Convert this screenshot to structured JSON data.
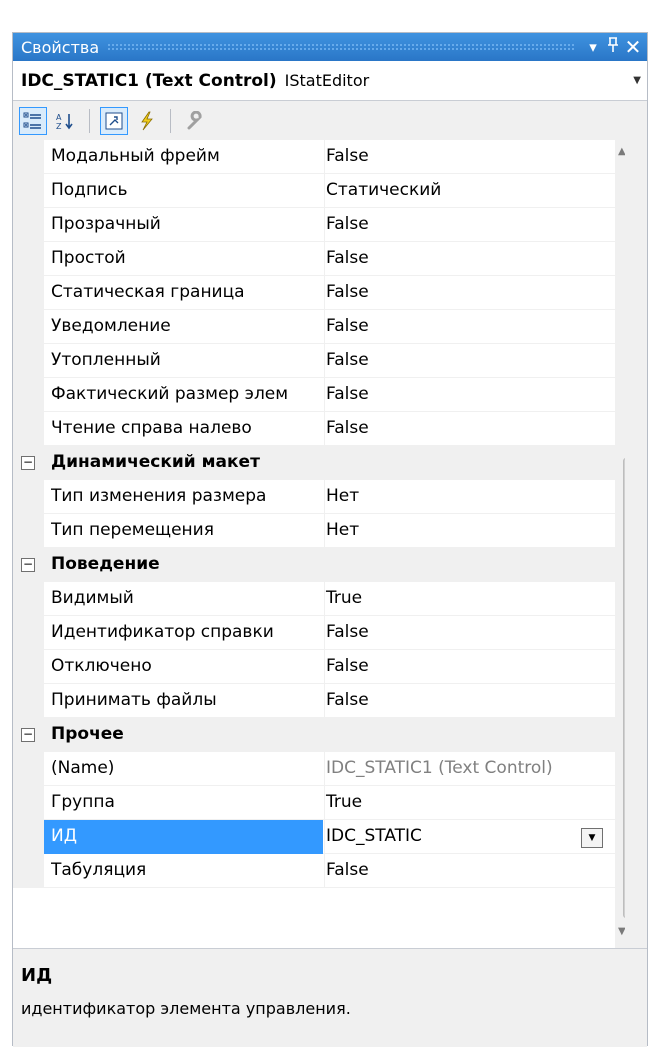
{
  "window": {
    "title": "Свойства",
    "buttons": {
      "dropdown": "▾",
      "pin": "ᛘ",
      "close": "✕"
    }
  },
  "object_selector": {
    "name": "IDC_STATIC1 (Text Control)",
    "type": "IStatEditor"
  },
  "toolbar": {
    "buttons": [
      {
        "name": "categorized-icon",
        "active": true
      },
      {
        "name": "alphabetical-icon",
        "active": false
      },
      {
        "name": "properties-icon",
        "active": true
      },
      {
        "name": "events-icon",
        "active": false
      },
      {
        "name": "property-pages-icon",
        "active": false
      }
    ]
  },
  "grid": {
    "rows": [
      {
        "kind": "prop",
        "name": "Модальный фрейм",
        "value": "False"
      },
      {
        "kind": "prop",
        "name": "Подпись",
        "value": "Статический"
      },
      {
        "kind": "prop",
        "name": "Прозрачный",
        "value": "False"
      },
      {
        "kind": "prop",
        "name": "Простой",
        "value": "False"
      },
      {
        "kind": "prop",
        "name": "Статическая граница",
        "value": "False"
      },
      {
        "kind": "prop",
        "name": "Уведомление",
        "value": "False"
      },
      {
        "kind": "prop",
        "name": "Утопленный",
        "value": "False"
      },
      {
        "kind": "prop",
        "name": "Фактический размер элем",
        "value": "False"
      },
      {
        "kind": "prop",
        "name": "Чтение справа налево",
        "value": "False"
      },
      {
        "kind": "cat",
        "name": "Динамический макет",
        "expander": "⊟"
      },
      {
        "kind": "prop",
        "name": "Тип изменения размера",
        "value": "Нет"
      },
      {
        "kind": "prop",
        "name": "Тип перемещения",
        "value": "Нет"
      },
      {
        "kind": "cat",
        "name": "Поведение",
        "expander": "⊟"
      },
      {
        "kind": "prop",
        "name": "Видимый",
        "value": "True"
      },
      {
        "kind": "prop",
        "name": "Идентификатор справки",
        "value": "False"
      },
      {
        "kind": "prop",
        "name": "Отключено",
        "value": "False"
      },
      {
        "kind": "prop",
        "name": "Принимать файлы",
        "value": "False"
      },
      {
        "kind": "cat",
        "name": "Прочее",
        "expander": "⊟"
      },
      {
        "kind": "prop",
        "name": "(Name)",
        "value": "IDC_STATIC1 (Text Control)",
        "gray": true
      },
      {
        "kind": "prop",
        "name": "Группа",
        "value": "True"
      },
      {
        "kind": "prop",
        "name": "ИД",
        "value": "IDC_STATIC",
        "selected": true,
        "dropdown": "▼"
      },
      {
        "kind": "prop",
        "name": "Табуляция",
        "value": "False"
      }
    ]
  },
  "scrollbar": {
    "up": "▲",
    "down": "▼"
  },
  "description": {
    "title": "ИД",
    "text": "идентификатор элемента управления."
  },
  "colors": {
    "titlebar": "#2a76c7",
    "selection": "#3399ff",
    "panel": "#f0f0f0"
  }
}
